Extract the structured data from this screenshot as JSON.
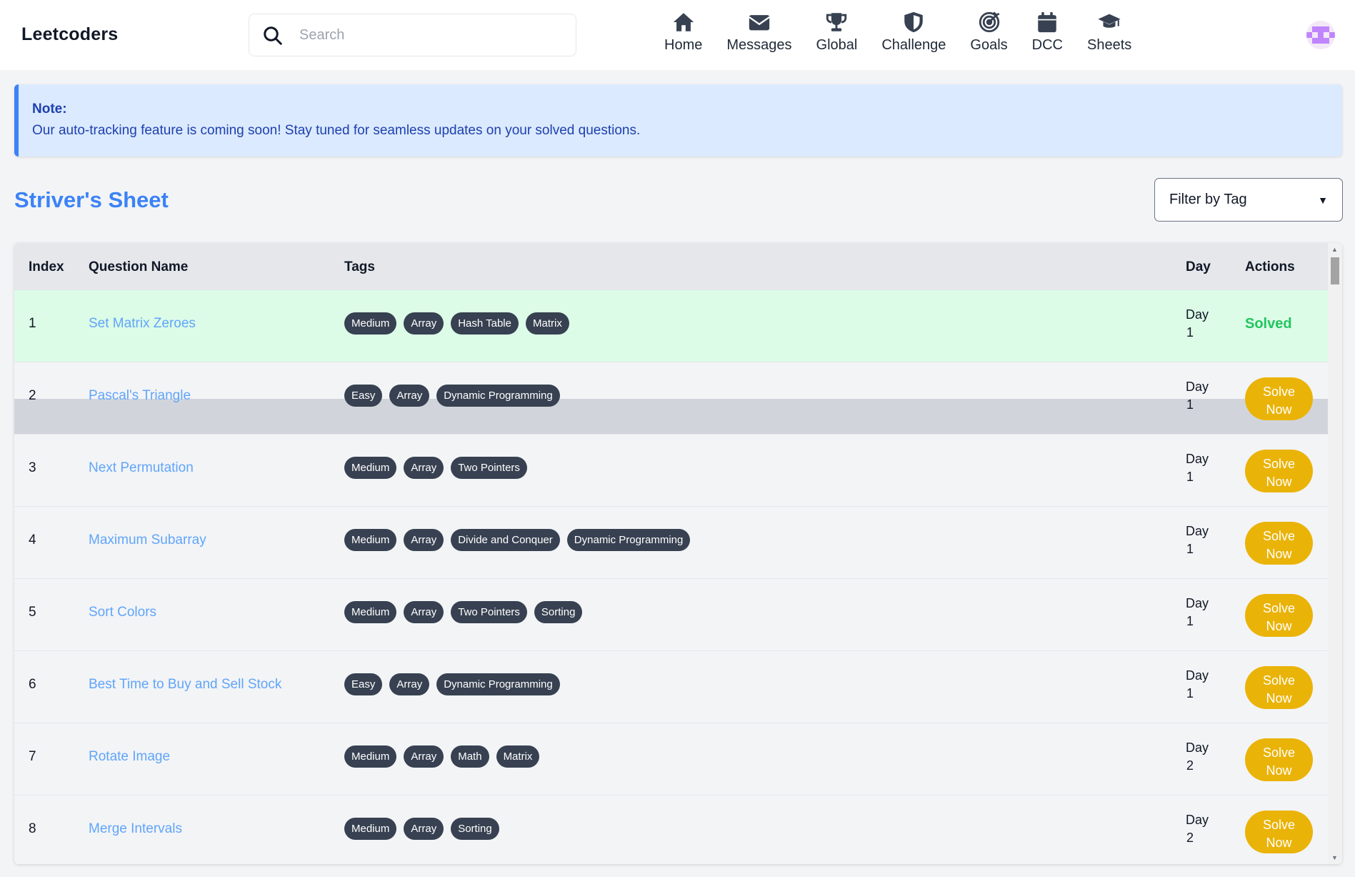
{
  "header": {
    "brand": "Leetcoders",
    "search_placeholder": "Search",
    "nav": [
      {
        "label": "Home",
        "icon": "home-icon"
      },
      {
        "label": "Messages",
        "icon": "envelope-icon"
      },
      {
        "label": "Global",
        "icon": "trophy-icon"
      },
      {
        "label": "Challenge",
        "icon": "shield-icon"
      },
      {
        "label": "Goals",
        "icon": "target-icon"
      },
      {
        "label": "DCC",
        "icon": "calendar-icon"
      },
      {
        "label": "Sheets",
        "icon": "graduation-cap-icon"
      }
    ]
  },
  "note": {
    "title": "Note:",
    "body": "Our auto-tracking feature is coming soon! Stay tuned for seamless updates on your solved questions."
  },
  "page": {
    "title": "Striver's Sheet",
    "filter_label": "Filter by Tag"
  },
  "table": {
    "headers": {
      "index": "Index",
      "name": "Question Name",
      "tags": "Tags",
      "day": "Day",
      "actions": "Actions"
    },
    "rows": [
      {
        "index": "1",
        "name": "Set Matrix Zeroes",
        "tags": [
          "Medium",
          "Array",
          "Hash Table",
          "Matrix"
        ],
        "day_label": "Day",
        "day_num": "1",
        "status": "Solved"
      },
      {
        "index": "2",
        "name": "Pascal's Triangle",
        "tags": [
          "Easy",
          "Array",
          "Dynamic Programming"
        ],
        "day_label": "Day",
        "day_num": "1",
        "action": "Solve Now"
      },
      {
        "index": "3",
        "name": "Next Permutation",
        "tags": [
          "Medium",
          "Array",
          "Two Pointers"
        ],
        "day_label": "Day",
        "day_num": "1",
        "action": "Solve Now"
      },
      {
        "index": "4",
        "name": "Maximum Subarray",
        "tags": [
          "Medium",
          "Array",
          "Divide and Conquer",
          "Dynamic Programming"
        ],
        "day_label": "Day",
        "day_num": "1",
        "action": "Solve Now"
      },
      {
        "index": "5",
        "name": "Sort Colors",
        "tags": [
          "Medium",
          "Array",
          "Two Pointers",
          "Sorting"
        ],
        "day_label": "Day",
        "day_num": "1",
        "action": "Solve Now"
      },
      {
        "index": "6",
        "name": "Best Time to Buy and Sell Stock",
        "tags": [
          "Easy",
          "Array",
          "Dynamic Programming"
        ],
        "day_label": "Day",
        "day_num": "1",
        "action": "Solve Now"
      },
      {
        "index": "7",
        "name": "Rotate Image",
        "tags": [
          "Medium",
          "Array",
          "Math",
          "Matrix"
        ],
        "day_label": "Day",
        "day_num": "2",
        "action": "Solve Now"
      },
      {
        "index": "8",
        "name": "Merge Intervals",
        "tags": [
          "Medium",
          "Array",
          "Sorting"
        ],
        "day_label": "Day",
        "day_num": "2",
        "action": "Solve Now"
      }
    ]
  },
  "colors": {
    "accent": "#3b82f6",
    "solved": "#22c55e",
    "solve_button": "#eab308",
    "tag_bg": "#374151",
    "link": "#60a5fa"
  }
}
